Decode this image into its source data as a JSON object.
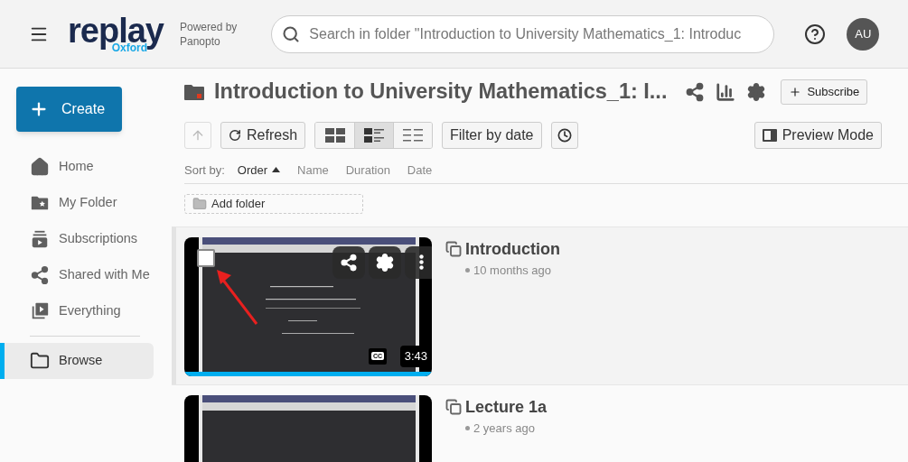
{
  "header": {
    "logo": {
      "word": "replay",
      "sub": "Oxford"
    },
    "powered_by": [
      "Powered by",
      "Panopto"
    ],
    "search": {
      "placeholder": "Search in folder \"Introduction to University Mathematics_1: Introduc"
    },
    "avatar": "AU"
  },
  "sidebar": {
    "create": "Create",
    "items": [
      {
        "kind": "home",
        "label": "Home",
        "selected": false
      },
      {
        "kind": "my-folder",
        "label": "My Folder",
        "selected": false
      },
      {
        "kind": "subscriptions",
        "label": "Subscriptions",
        "selected": false
      },
      {
        "kind": "shared",
        "label": "Shared with Me",
        "selected": false
      },
      {
        "kind": "everything",
        "label": "Everything",
        "selected": false
      },
      {
        "kind": "browse",
        "label": "Browse",
        "selected": true
      }
    ]
  },
  "folder": {
    "title": "Introduction to University Mathematics_1: I...",
    "subscribe": "Subscribe",
    "toolbar": {
      "refresh": "Refresh",
      "view_modes": [
        {
          "kind": "grid",
          "selected": false
        },
        {
          "kind": "detail",
          "selected": true
        },
        {
          "kind": "list",
          "selected": false
        }
      ],
      "filter": "Filter by date",
      "preview": "Preview Mode"
    },
    "sort": {
      "label": "Sort by:",
      "options": [
        {
          "label": "Order",
          "selected": true
        },
        {
          "label": "Name",
          "selected": false
        },
        {
          "label": "Duration",
          "selected": false
        },
        {
          "label": "Date",
          "selected": false
        }
      ]
    },
    "add_folder": "Add folder",
    "sessions": [
      {
        "title": "Introduction",
        "age": "10 months ago",
        "duration": "3:43",
        "captions": "CC",
        "hovered": true,
        "level": 1
      },
      {
        "title": "Lecture 1a",
        "age": "2 years ago",
        "hovered": false
      }
    ]
  }
}
